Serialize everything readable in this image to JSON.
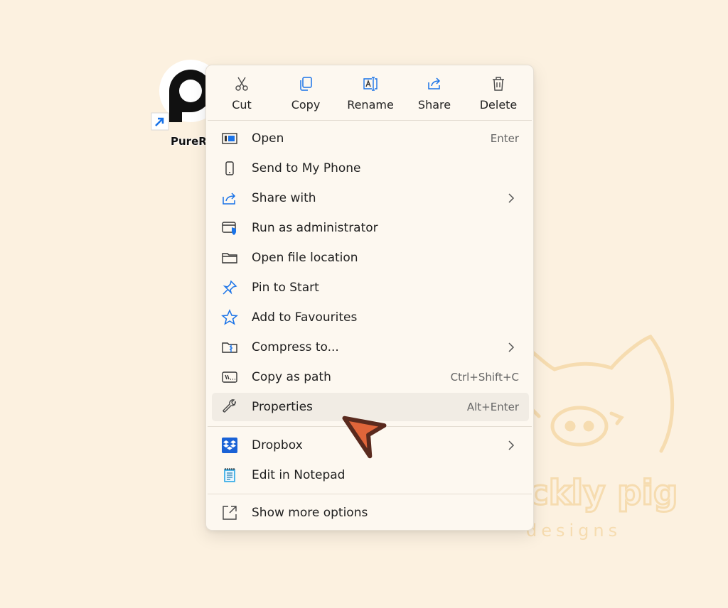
{
  "desktop": {
    "shortcut_label": "PureRef"
  },
  "toolbar": [
    {
      "id": "cut",
      "label": "Cut",
      "icon": "scissors-icon"
    },
    {
      "id": "copy",
      "label": "Copy",
      "icon": "copy-icon"
    },
    {
      "id": "rename",
      "label": "Rename",
      "icon": "rename-icon"
    },
    {
      "id": "share",
      "label": "Share",
      "icon": "share-icon"
    },
    {
      "id": "delete",
      "label": "Delete",
      "icon": "trash-icon"
    }
  ],
  "menu": {
    "items": [
      {
        "label": "Open",
        "shortcut": "Enter",
        "icon": "open-window-icon"
      },
      {
        "label": "Send to My Phone",
        "icon": "phone-icon"
      },
      {
        "label": "Share with",
        "icon": "share-with-icon",
        "submenu": true
      },
      {
        "label": "Run as administrator",
        "icon": "admin-shield-icon"
      },
      {
        "label": "Open file location",
        "icon": "folder-icon"
      },
      {
        "label": "Pin to Start",
        "icon": "pin-icon"
      },
      {
        "label": "Add to Favourites",
        "icon": "star-icon"
      },
      {
        "label": "Compress to...",
        "icon": "zip-folder-icon",
        "submenu": true
      },
      {
        "label": "Copy as path",
        "shortcut": "Ctrl+Shift+C",
        "icon": "path-icon"
      },
      {
        "label": "Properties",
        "shortcut": "Alt+Enter",
        "icon": "wrench-icon",
        "hovered": true
      }
    ],
    "group2": [
      {
        "label": "Dropbox",
        "icon": "dropbox-icon",
        "submenu": true
      },
      {
        "label": "Edit in Notepad",
        "icon": "notepad-icon"
      }
    ],
    "more": {
      "label": "Show more options",
      "icon": "expand-icon"
    }
  },
  "watermark": {
    "line1": "Prickly pig",
    "line2": "designs"
  },
  "colors": {
    "accent": "#1a73e8",
    "background": "#fcf1e0",
    "cursor": "#e0653a",
    "watermark": "#f6d9a8"
  }
}
